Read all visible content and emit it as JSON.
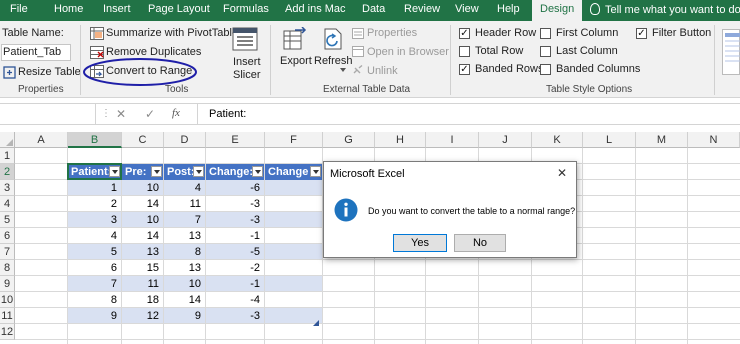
{
  "tabs": {
    "file": "File",
    "home": "Home",
    "insert": "Insert",
    "page_layout": "Page Layout",
    "formulas": "Formulas",
    "addins": "Add ins Mac",
    "data": "Data",
    "review": "Review",
    "view": "View",
    "help": "Help",
    "design": "Design",
    "tell_me": "Tell me what you want to do"
  },
  "ribbon": {
    "properties": {
      "table_name_label": "Table Name:",
      "table_name_value": "Patient_Tab",
      "resize_table": "Resize Table",
      "group_label": "Properties"
    },
    "tools": {
      "summarize": "Summarize with PivotTable",
      "remove_duplicates": "Remove Duplicates",
      "convert_to_range": "Convert to Range",
      "insert_slicer_1": "Insert",
      "insert_slicer_2": "Slicer",
      "group_label": "Tools"
    },
    "external": {
      "export": "Export",
      "refresh": "Refresh",
      "properties": "Properties",
      "open_in_browser": "Open in Browser",
      "unlink": "Unlink",
      "group_label": "External Table Data"
    },
    "style_options": {
      "header_row": "Header Row",
      "total_row": "Total Row",
      "banded_rows": "Banded Rows",
      "first_column": "First Column",
      "last_column": "Last Column",
      "banded_columns": "Banded Columns",
      "filter_button": "Filter Button",
      "checked": {
        "header_row": true,
        "total_row": false,
        "banded_rows": true,
        "first_column": false,
        "last_column": false,
        "banded_columns": false,
        "filter_button": true
      },
      "group_label": "Table Style Options"
    }
  },
  "formula_bar": {
    "content": "Patient:",
    "cancel": "✕",
    "enter": "✓",
    "fx": "fx"
  },
  "columns": [
    "A",
    "B",
    "C",
    "D",
    "E",
    "F",
    "G",
    "H",
    "I",
    "J",
    "K",
    "L",
    "M",
    "N"
  ],
  "rows": [
    "1",
    "2",
    "3",
    "4",
    "5",
    "6",
    "7",
    "8",
    "9",
    "10",
    "11",
    "12"
  ],
  "table": {
    "headers": [
      "Patient:",
      "Pre:",
      "Post:",
      "Change:",
      "Change"
    ],
    "data": [
      [
        "1",
        "10",
        "4",
        "-6"
      ],
      [
        "2",
        "14",
        "11",
        "-3"
      ],
      [
        "3",
        "10",
        "7",
        "-3"
      ],
      [
        "4",
        "14",
        "13",
        "-1"
      ],
      [
        "5",
        "13",
        "8",
        "-5"
      ],
      [
        "6",
        "15",
        "13",
        "-2"
      ],
      [
        "7",
        "11",
        "10",
        "-1"
      ],
      [
        "8",
        "18",
        "14",
        "-4"
      ],
      [
        "9",
        "12",
        "9",
        "-3"
      ]
    ]
  },
  "dialog": {
    "title": "Microsoft Excel",
    "message": "Do you want to convert the table to a normal range?",
    "yes": "Yes",
    "no": "No",
    "close": "✕"
  },
  "colors": {
    "excel_green": "#217346",
    "table_header": "#4472c4",
    "band": "#d9e1f2",
    "highlight_oval": "#1f1fa8"
  }
}
